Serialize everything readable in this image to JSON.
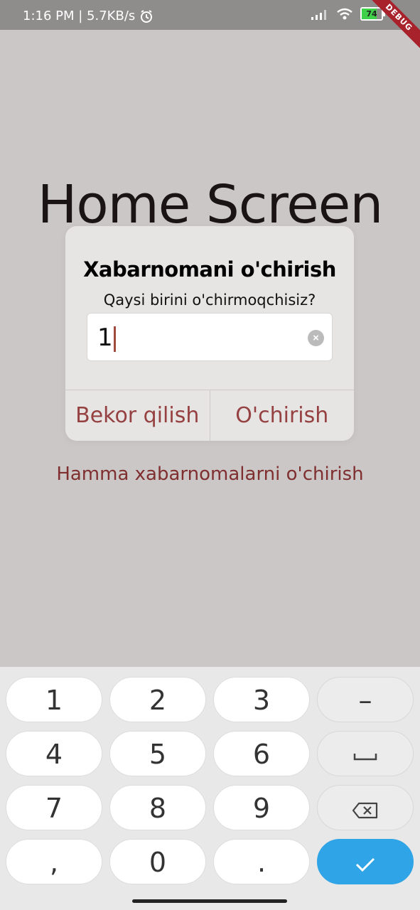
{
  "status_bar": {
    "time_speed": "1:16 PM | 5.7KB/s",
    "battery": "74",
    "debug_label": "DEBUG"
  },
  "home": {
    "title": "Home Screen"
  },
  "dialog": {
    "title": "Xabarnomani o'chirish",
    "subtitle": "Qaysi birini o'chirmoqchisiz?",
    "input_value": "1",
    "cancel_label": "Bekor qilish",
    "delete_label": "O'chirish"
  },
  "delete_all_label": "Hamma xabarnomalarni o'chirish",
  "keyboard": {
    "keys": [
      {
        "label": "1"
      },
      {
        "label": "2"
      },
      {
        "label": "3"
      },
      {
        "label": "–"
      },
      {
        "label": "4"
      },
      {
        "label": "5"
      },
      {
        "label": "6"
      },
      {
        "label": "space"
      },
      {
        "label": "7"
      },
      {
        "label": "8"
      },
      {
        "label": "9"
      },
      {
        "label": "backspace"
      },
      {
        "label": ","
      },
      {
        "label": "0"
      },
      {
        "label": "."
      },
      {
        "label": "done"
      }
    ],
    "done_color": "#2fa4e6"
  },
  "colors": {
    "accent": "#964141",
    "background": "#ccc7c7"
  }
}
